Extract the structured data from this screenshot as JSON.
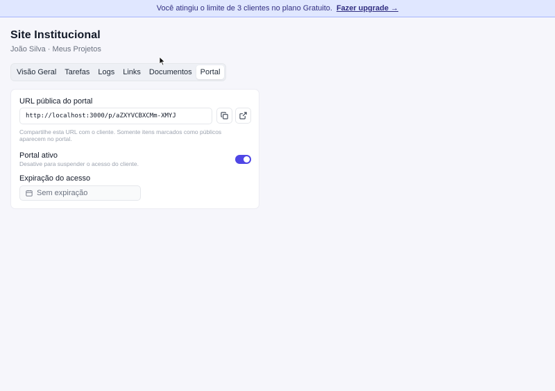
{
  "banner": {
    "message": "Você atingiu o limite de 3 clientes no plano Gratuito.",
    "cta": "Fazer upgrade →"
  },
  "project": {
    "title": "Site Institucional",
    "breadcrumb": "João Silva · Meus Projetos"
  },
  "tabs": [
    {
      "label": "Visão Geral"
    },
    {
      "label": "Tarefas"
    },
    {
      "label": "Logs"
    },
    {
      "label": "Links"
    },
    {
      "label": "Documentos"
    },
    {
      "label": "Portal",
      "active": true
    }
  ],
  "portal": {
    "url_label": "URL pública do portal",
    "url_value": "http://localhost:3000/p/aZXYVCBXCMm-XMYJ",
    "copy_icon": "copy-icon",
    "open_icon": "external-link-icon",
    "help_text": "Compartilhe esta URL com o cliente. Somente itens marcados como públicos aparecem no portal.",
    "active_label": "Portal ativo",
    "active_desc": "Desative para suspender o acesso do cliente.",
    "active": true,
    "expiration_label": "Expiração do acesso",
    "expiration_placeholder": "Sem expiração",
    "calendar_icon": "calendar-icon"
  },
  "colors": {
    "accent": "#4f46e5",
    "banner_bg": "#e0e7ff",
    "background": "#f6f6fb"
  }
}
